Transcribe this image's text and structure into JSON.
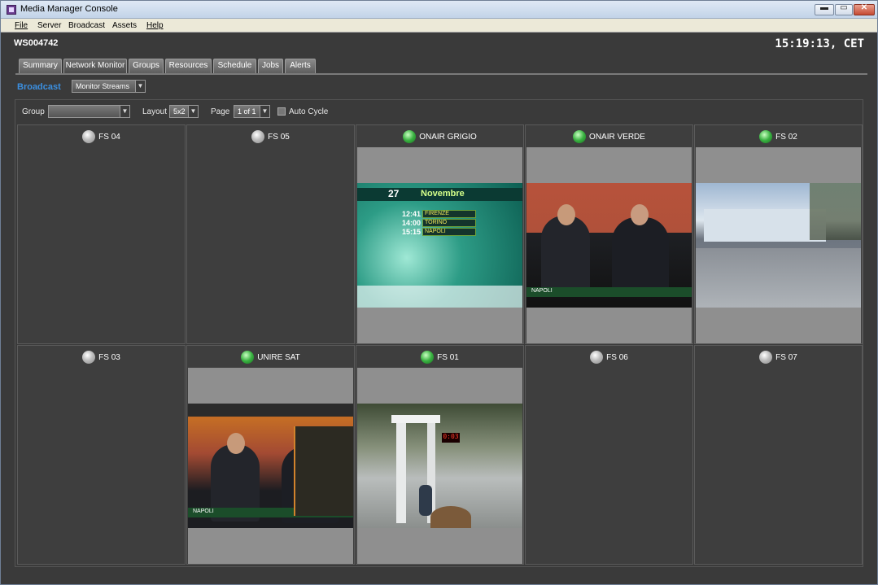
{
  "window": {
    "title": "Media Manager Console",
    "minimize": "▬",
    "maximize": "▭",
    "close": "✕"
  },
  "menu": [
    "File",
    "Server",
    "Broadcast",
    "Assets",
    "Help"
  ],
  "header": {
    "workstation": "WS004742",
    "clock": "15:19:13, CET"
  },
  "tabs": [
    "Summary",
    "Network Monitor",
    "Groups",
    "Resources",
    "Schedule",
    "Jobs",
    "Alerts"
  ],
  "active_tab": "Network Monitor",
  "broadcast": {
    "section_label": "Broadcast",
    "view_select": "Monitor Streams"
  },
  "toolbar": {
    "group_label": "Group",
    "group_value": "",
    "layout_label": "Layout",
    "layout_value": "5x2",
    "page_label": "Page",
    "page_value": "1 of 1",
    "auto_cycle_label": "Auto Cycle",
    "auto_cycle_checked": false
  },
  "streams": [
    {
      "name": "FS 04",
      "status": "off",
      "feed": null
    },
    {
      "name": "FS 05",
      "status": "off",
      "feed": null
    },
    {
      "name": "ONAIR GRIGIO",
      "status": "on",
      "feed": "teletext"
    },
    {
      "name": "ONAIR VERDE",
      "status": "on",
      "feed": "studio"
    },
    {
      "name": "FS 02",
      "status": "on",
      "feed": "outdoor"
    },
    {
      "name": "FS 03",
      "status": "off",
      "feed": null
    },
    {
      "name": "UNIRE SAT",
      "status": "on",
      "feed": "studio2"
    },
    {
      "name": "FS 01",
      "status": "on",
      "feed": "race"
    },
    {
      "name": "FS 06",
      "status": "off",
      "feed": null
    },
    {
      "name": "FS 07",
      "status": "off",
      "feed": null
    }
  ],
  "feed_text": {
    "teletext_day": "27",
    "teletext_month": "Novembre",
    "teletext_times": [
      "12:41",
      "14:00",
      "15:15"
    ],
    "teletext_lines": [
      "FIRENZE",
      "TORINO",
      "NAPOLI"
    ],
    "studio_caption": "NAPOLI",
    "race_timer": "0:03"
  }
}
